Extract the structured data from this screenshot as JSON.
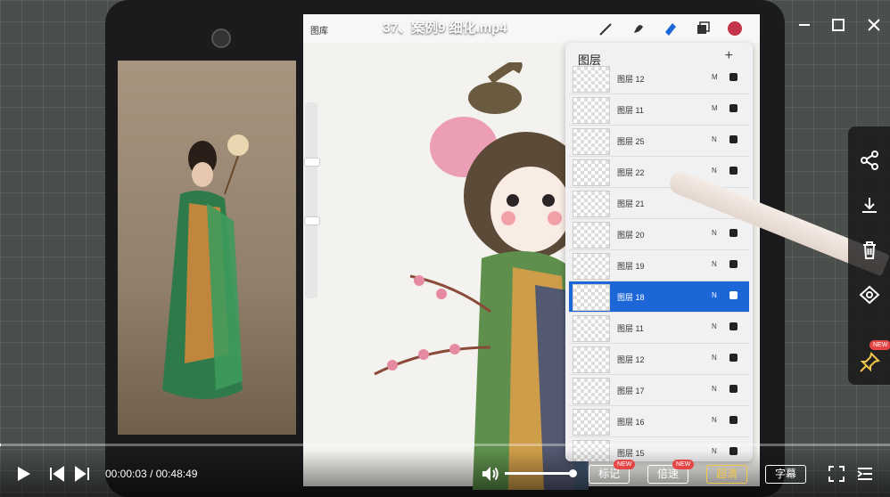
{
  "player": {
    "title": "37、案例9 细化.mp4",
    "time_current": "00:00:03",
    "time_separator": "/",
    "time_total": "00:48:49",
    "progress_fraction": 0.001,
    "volume_fraction": 1.0,
    "buttons": {
      "mark_label": "标记",
      "speed_label": "倍速",
      "quality_label": "超清",
      "subtitle_label": "字幕",
      "new_badge": "NEW"
    },
    "window_controls": {
      "minimize": "minimize-icon",
      "maximize": "maximize-icon",
      "close": "close-icon"
    }
  },
  "side_tools": {
    "items": [
      "share-icon",
      "download-icon",
      "delete-icon",
      "preview-eye-icon",
      "pin-icon"
    ],
    "new_badge": "NEW"
  },
  "procreate": {
    "menu_label": "图库",
    "layers_title": "图层",
    "add_layer": "+",
    "layers": [
      {
        "name": "图层 12",
        "mode": "M",
        "visible": true,
        "selected": false
      },
      {
        "name": "图层 11",
        "mode": "M",
        "visible": true,
        "selected": false
      },
      {
        "name": "图层 25",
        "mode": "N",
        "visible": true,
        "selected": false
      },
      {
        "name": "图层 22",
        "mode": "N",
        "visible": true,
        "selected": false
      },
      {
        "name": "图层 21",
        "mode": "N",
        "visible": true,
        "selected": false
      },
      {
        "name": "图层 20",
        "mode": "N",
        "visible": true,
        "selected": false
      },
      {
        "name": "图层 19",
        "mode": "N",
        "visible": true,
        "selected": false
      },
      {
        "name": "图层 18",
        "mode": "N",
        "visible": true,
        "selected": true
      },
      {
        "name": "图层 11",
        "mode": "N",
        "visible": true,
        "selected": false
      },
      {
        "name": "图层 12",
        "mode": "N",
        "visible": true,
        "selected": false
      },
      {
        "name": "图层 17",
        "mode": "N",
        "visible": true,
        "selected": false
      },
      {
        "name": "图层 16",
        "mode": "N",
        "visible": true,
        "selected": false
      },
      {
        "name": "图层 15",
        "mode": "N",
        "visible": true,
        "selected": false
      }
    ]
  },
  "colors": {
    "accent_selected_layer": "#1c66d8",
    "quality_active": "#f3c74b",
    "new_badge": "#e64545"
  }
}
